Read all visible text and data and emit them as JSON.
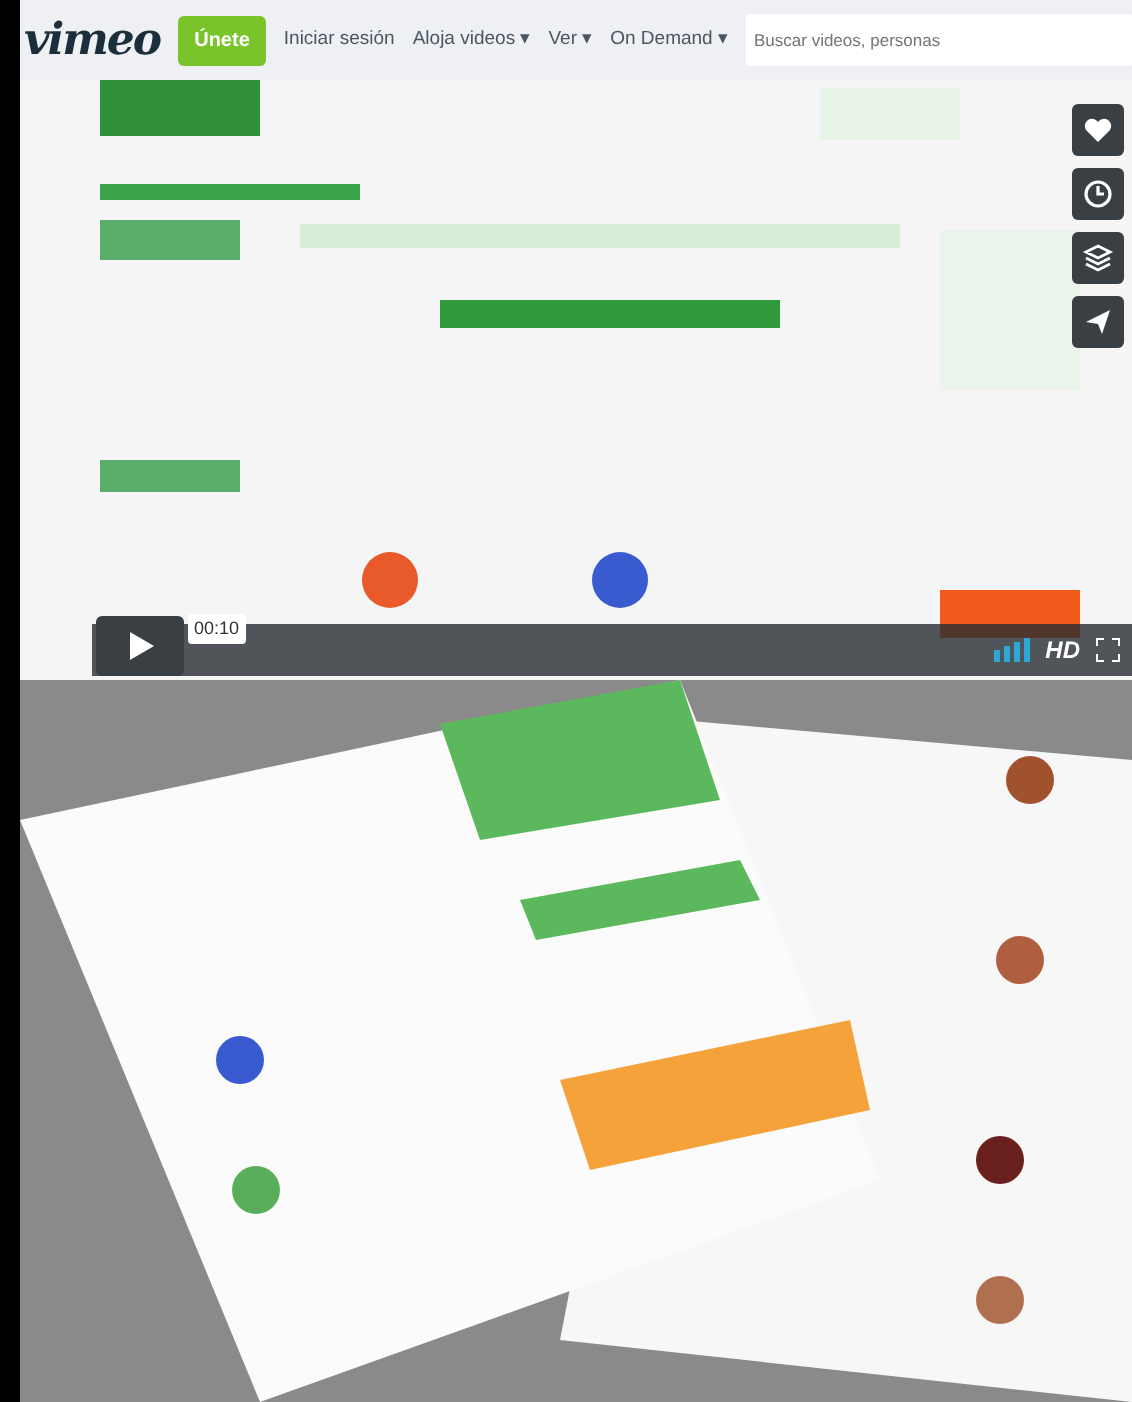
{
  "header": {
    "logo": "vimeo",
    "join_button": "Únete",
    "nav": [
      {
        "label": "Iniciar sesión"
      },
      {
        "label": "Aloja videos",
        "caret": "▾"
      },
      {
        "label": "Ver",
        "caret": "▾"
      },
      {
        "label": "On Demand",
        "caret": "▾"
      }
    ],
    "search": {
      "placeholder": "Buscar videos, personas"
    }
  },
  "player": {
    "time": "00:10",
    "quality": "HD"
  }
}
